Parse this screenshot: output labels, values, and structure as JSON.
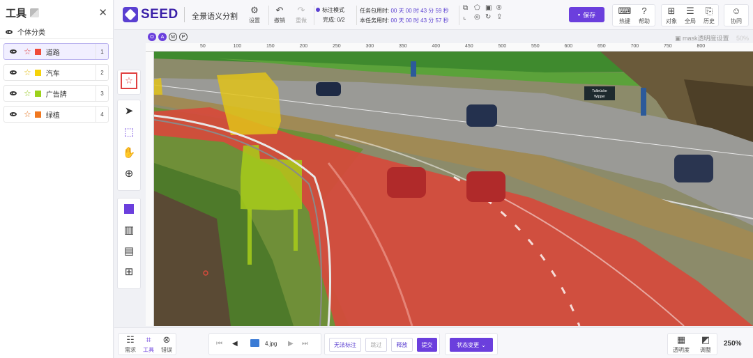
{
  "sidebar": {
    "title": "工具",
    "subtitle": "个体分类",
    "classes": [
      {
        "label": "道路",
        "color": "#f04a38",
        "star": "#e04040",
        "num": "1"
      },
      {
        "label": "汽车",
        "color": "#f5d30a",
        "star": "#e0b800",
        "num": "2"
      },
      {
        "label": "广告牌",
        "color": "#9cd21a",
        "star": "#88c000",
        "num": "3"
      },
      {
        "label": "绿植",
        "color": "#f07820",
        "star": "#e06000",
        "num": "4"
      }
    ]
  },
  "topbar": {
    "brand": "SEED",
    "mode": "全景语义分割",
    "settings": "设置",
    "undo": "撤销",
    "redo": "重做",
    "label_mode": "标注模式",
    "done": "完成: 0/2",
    "timer1_label": "任务包用时:",
    "timer1": "00 天 00 时 43 分 59 秒",
    "timer2_label": "本任务用时:",
    "timer2": "00 天 00 时 43 分 57 秒",
    "save": "保存",
    "hotkey": "热键",
    "help": "帮助",
    "object": "对象",
    "global": "全局",
    "history": "历史",
    "collab": "协同"
  },
  "canvas": {
    "mask_label": "mask透明度设置",
    "mask_value": "50%",
    "modes": [
      "O",
      "A",
      "M",
      "P"
    ],
    "ruler": [
      "50",
      "100",
      "150",
      "200",
      "250",
      "300",
      "350",
      "400",
      "450",
      "500",
      "550",
      "600",
      "650",
      "700",
      "750",
      "800"
    ],
    "sign_text": "Talbrücke\nWipper"
  },
  "bottom": {
    "need": "需求",
    "tool": "工具",
    "error": "错误",
    "file": "4.jpg",
    "no_label": "无法标注",
    "skip": "跳过",
    "release": "释放",
    "submit": "提交",
    "state": "状态变更",
    "opacity": "透明度",
    "adjust": "调整",
    "zoom": "250%"
  }
}
